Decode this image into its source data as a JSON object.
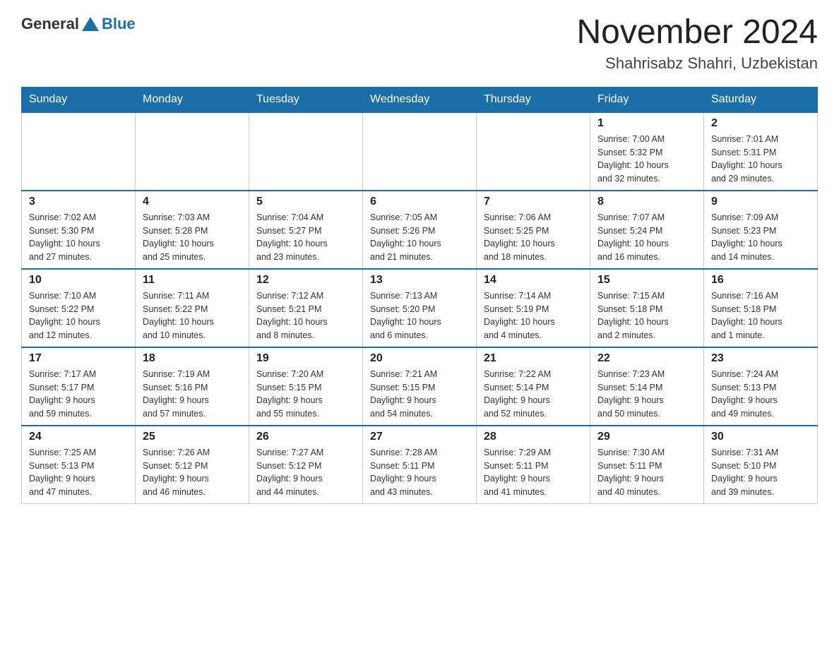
{
  "header": {
    "logo": {
      "general": "General",
      "blue": "Blue"
    },
    "title": "November 2024",
    "subtitle": "Shahrisabz Shahri, Uzbekistan"
  },
  "weekdays": [
    "Sunday",
    "Monday",
    "Tuesday",
    "Wednesday",
    "Thursday",
    "Friday",
    "Saturday"
  ],
  "weeks": [
    {
      "days": [
        {
          "number": "",
          "info": ""
        },
        {
          "number": "",
          "info": ""
        },
        {
          "number": "",
          "info": ""
        },
        {
          "number": "",
          "info": ""
        },
        {
          "number": "",
          "info": ""
        },
        {
          "number": "1",
          "info": "Sunrise: 7:00 AM\nSunset: 5:32 PM\nDaylight: 10 hours\nand 32 minutes."
        },
        {
          "number": "2",
          "info": "Sunrise: 7:01 AM\nSunset: 5:31 PM\nDaylight: 10 hours\nand 29 minutes."
        }
      ]
    },
    {
      "days": [
        {
          "number": "3",
          "info": "Sunrise: 7:02 AM\nSunset: 5:30 PM\nDaylight: 10 hours\nand 27 minutes."
        },
        {
          "number": "4",
          "info": "Sunrise: 7:03 AM\nSunset: 5:28 PM\nDaylight: 10 hours\nand 25 minutes."
        },
        {
          "number": "5",
          "info": "Sunrise: 7:04 AM\nSunset: 5:27 PM\nDaylight: 10 hours\nand 23 minutes."
        },
        {
          "number": "6",
          "info": "Sunrise: 7:05 AM\nSunset: 5:26 PM\nDaylight: 10 hours\nand 21 minutes."
        },
        {
          "number": "7",
          "info": "Sunrise: 7:06 AM\nSunset: 5:25 PM\nDaylight: 10 hours\nand 18 minutes."
        },
        {
          "number": "8",
          "info": "Sunrise: 7:07 AM\nSunset: 5:24 PM\nDaylight: 10 hours\nand 16 minutes."
        },
        {
          "number": "9",
          "info": "Sunrise: 7:09 AM\nSunset: 5:23 PM\nDaylight: 10 hours\nand 14 minutes."
        }
      ]
    },
    {
      "days": [
        {
          "number": "10",
          "info": "Sunrise: 7:10 AM\nSunset: 5:22 PM\nDaylight: 10 hours\nand 12 minutes."
        },
        {
          "number": "11",
          "info": "Sunrise: 7:11 AM\nSunset: 5:22 PM\nDaylight: 10 hours\nand 10 minutes."
        },
        {
          "number": "12",
          "info": "Sunrise: 7:12 AM\nSunset: 5:21 PM\nDaylight: 10 hours\nand 8 minutes."
        },
        {
          "number": "13",
          "info": "Sunrise: 7:13 AM\nSunset: 5:20 PM\nDaylight: 10 hours\nand 6 minutes."
        },
        {
          "number": "14",
          "info": "Sunrise: 7:14 AM\nSunset: 5:19 PM\nDaylight: 10 hours\nand 4 minutes."
        },
        {
          "number": "15",
          "info": "Sunrise: 7:15 AM\nSunset: 5:18 PM\nDaylight: 10 hours\nand 2 minutes."
        },
        {
          "number": "16",
          "info": "Sunrise: 7:16 AM\nSunset: 5:18 PM\nDaylight: 10 hours\nand 1 minute."
        }
      ]
    },
    {
      "days": [
        {
          "number": "17",
          "info": "Sunrise: 7:17 AM\nSunset: 5:17 PM\nDaylight: 9 hours\nand 59 minutes."
        },
        {
          "number": "18",
          "info": "Sunrise: 7:19 AM\nSunset: 5:16 PM\nDaylight: 9 hours\nand 57 minutes."
        },
        {
          "number": "19",
          "info": "Sunrise: 7:20 AM\nSunset: 5:15 PM\nDaylight: 9 hours\nand 55 minutes."
        },
        {
          "number": "20",
          "info": "Sunrise: 7:21 AM\nSunset: 5:15 PM\nDaylight: 9 hours\nand 54 minutes."
        },
        {
          "number": "21",
          "info": "Sunrise: 7:22 AM\nSunset: 5:14 PM\nDaylight: 9 hours\nand 52 minutes."
        },
        {
          "number": "22",
          "info": "Sunrise: 7:23 AM\nSunset: 5:14 PM\nDaylight: 9 hours\nand 50 minutes."
        },
        {
          "number": "23",
          "info": "Sunrise: 7:24 AM\nSunset: 5:13 PM\nDaylight: 9 hours\nand 49 minutes."
        }
      ]
    },
    {
      "days": [
        {
          "number": "24",
          "info": "Sunrise: 7:25 AM\nSunset: 5:13 PM\nDaylight: 9 hours\nand 47 minutes."
        },
        {
          "number": "25",
          "info": "Sunrise: 7:26 AM\nSunset: 5:12 PM\nDaylight: 9 hours\nand 46 minutes."
        },
        {
          "number": "26",
          "info": "Sunrise: 7:27 AM\nSunset: 5:12 PM\nDaylight: 9 hours\nand 44 minutes."
        },
        {
          "number": "27",
          "info": "Sunrise: 7:28 AM\nSunset: 5:11 PM\nDaylight: 9 hours\nand 43 minutes."
        },
        {
          "number": "28",
          "info": "Sunrise: 7:29 AM\nSunset: 5:11 PM\nDaylight: 9 hours\nand 41 minutes."
        },
        {
          "number": "29",
          "info": "Sunrise: 7:30 AM\nSunset: 5:11 PM\nDaylight: 9 hours\nand 40 minutes."
        },
        {
          "number": "30",
          "info": "Sunrise: 7:31 AM\nSunset: 5:10 PM\nDaylight: 9 hours\nand 39 minutes."
        }
      ]
    }
  ]
}
